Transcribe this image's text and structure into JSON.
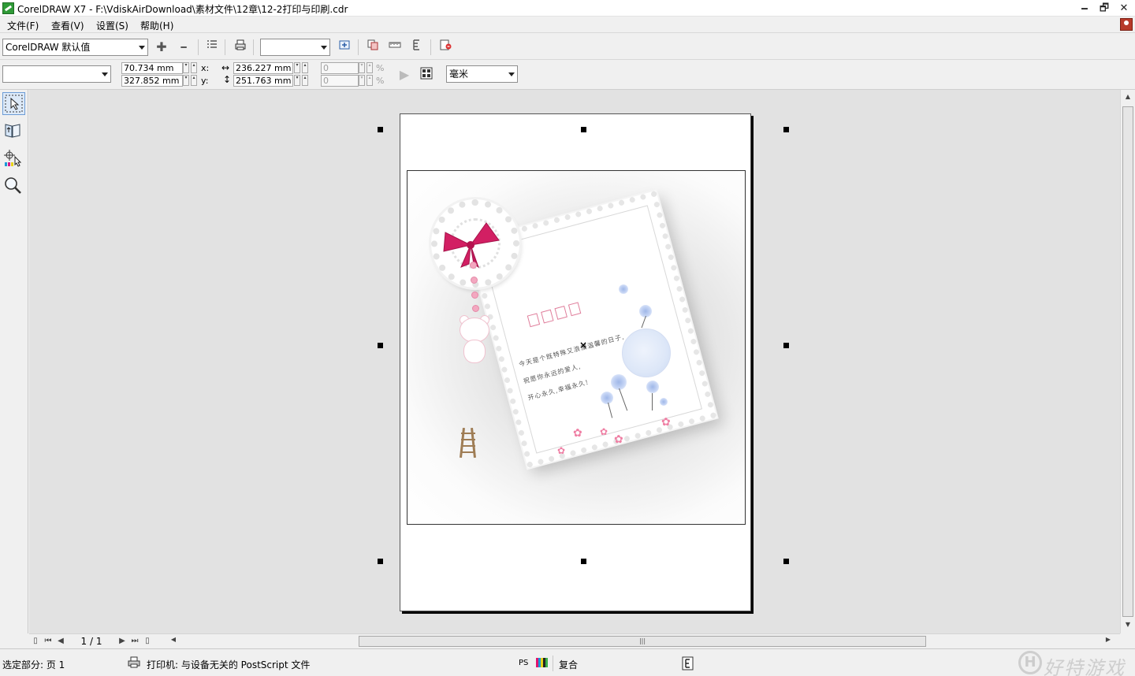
{
  "window": {
    "title": "CorelDRAW X7 - F:\\VdiskAirDownload\\素材文件\\12章\\12-2打印与印刷.cdr",
    "minimize_glyph": "🗕",
    "restore_glyph": "🗗",
    "close_glyph": "✕"
  },
  "menu": {
    "items": [
      {
        "label": "文件(F)"
      },
      {
        "label": "查看(V)"
      },
      {
        "label": "设置(S)"
      },
      {
        "label": "帮助(H)"
      }
    ]
  },
  "toolbar": {
    "preset_value": "CorelDRAW 默认值",
    "add_glyph": "✚",
    "remove_glyph": "━",
    "printer_combo_value": ""
  },
  "property_bar": {
    "style_combo_value": "",
    "pos_x": "70.734 mm",
    "pos_y": "327.852 mm",
    "x_label": "x:",
    "y_label": "y:",
    "width": "236.227 mm",
    "height": "251.763 mm",
    "scale_x": "0",
    "scale_y": "0",
    "percent_label": "%",
    "units": "毫米"
  },
  "document": {
    "card_text_lines": [
      "今天是个既特殊又浪漫温馨的日子,",
      "祝愿你永远的爱人,",
      "开心永久,幸福永久!"
    ],
    "center_marker": "×"
  },
  "navigation": {
    "page_counter": "1 / 1",
    "scroll_grip": "|||"
  },
  "status": {
    "selection": "选定部分: 页 1",
    "printer": "打印机: 与设备无关的 PostScript 文件",
    "ps_label": "PS",
    "mode": "复合"
  },
  "watermark": {
    "logo_letter": "H",
    "text": "好特游戏"
  },
  "colors": {
    "accent": "#2f9a37",
    "bow": "#d21f63",
    "flower": "#ef7fa4",
    "dandelion": "#9fb7e8"
  }
}
